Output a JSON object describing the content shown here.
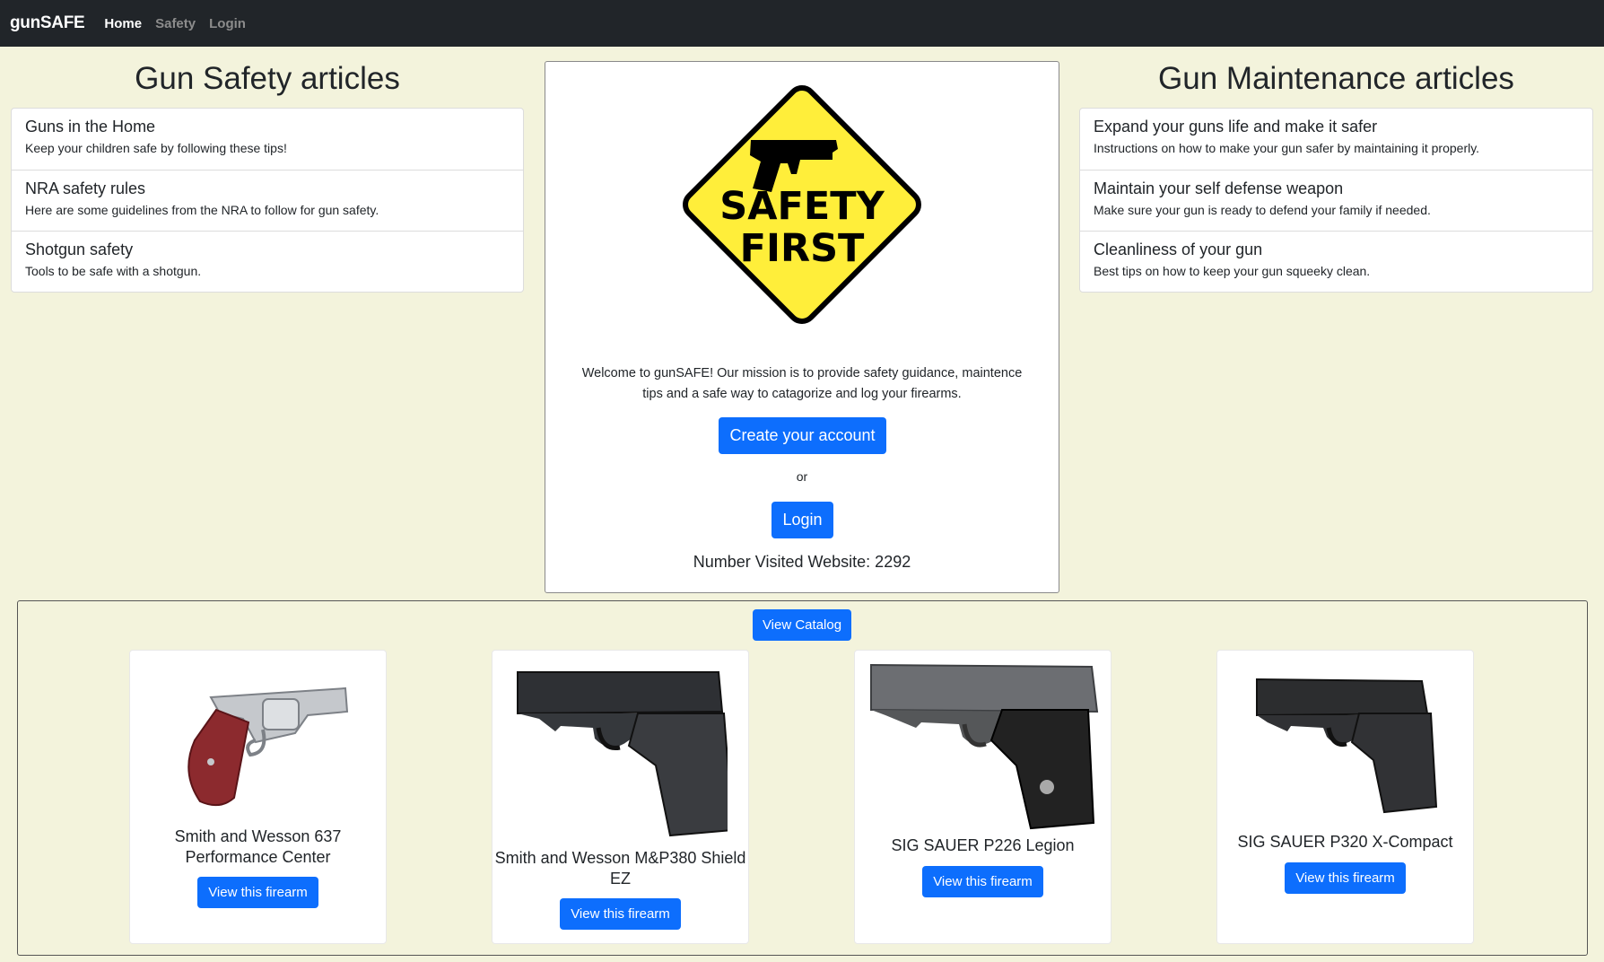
{
  "nav": {
    "brand": "gunSAFE",
    "links": [
      {
        "label": "Home",
        "active": true
      },
      {
        "label": "Safety",
        "active": false
      },
      {
        "label": "Login",
        "active": false
      }
    ]
  },
  "safety": {
    "title": "Gun Safety articles",
    "articles": [
      {
        "title": "Guns in the Home",
        "desc": "Keep your children safe by following these tips!"
      },
      {
        "title": "NRA safety rules",
        "desc": "Here are some guidelines from the NRA to follow for gun safety."
      },
      {
        "title": "Shotgun safety",
        "desc": "Tools to be safe with a shotgun."
      }
    ]
  },
  "maintenance": {
    "title": "Gun Maintenance articles",
    "articles": [
      {
        "title": "Expand your guns life and make it safer",
        "desc": "Instructions on how to make your gun safer by maintaining it properly."
      },
      {
        "title": "Maintain your self defense weapon",
        "desc": "Make sure your gun is ready to defend your family if needed."
      },
      {
        "title": "Cleanliness of your gun",
        "desc": "Best tips on how to keep your gun squeeky clean."
      }
    ]
  },
  "center": {
    "sign_line1": "SAFETY",
    "sign_line2": "FIRST",
    "welcome": "Welcome to gunSAFE! Our mission is to provide safety guidance, maintence tips and a safe way to catagorize and log your firearms.",
    "create_label": "Create your account",
    "or_label": "or",
    "login_label": "Login",
    "visits": "Number Visited Website: 2292"
  },
  "catalog": {
    "button": "View Catalog",
    "firearms": [
      {
        "name": "Smith and Wesson 637 Performance Center",
        "button": "View this firearm"
      },
      {
        "name": "Smith and Wesson M&P380 Shield EZ",
        "button": "View this firearm"
      },
      {
        "name": "SIG SAUER P226 Legion",
        "button": "View this firearm"
      },
      {
        "name": "SIG SAUER P320 X-Compact",
        "button": "View this firearm"
      }
    ]
  },
  "colors": {
    "navbar": "#212529",
    "page_bg": "#f3f3dc",
    "primary": "#0d6efd",
    "sign_yellow": "#ffee3a"
  }
}
